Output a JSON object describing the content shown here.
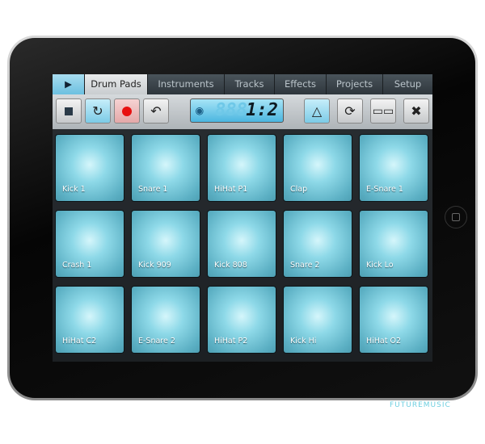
{
  "tabs": {
    "play_icon": "play-icon",
    "items": [
      "Drum Pads",
      "Instruments",
      "Tracks",
      "Effects",
      "Projects",
      "Setup"
    ],
    "active": "Drum Pads"
  },
  "toolbar": {
    "stop_icon": "stop-icon",
    "loop_icon": "loop-icon",
    "record_icon": "record-icon",
    "undo_icon": "undo-icon",
    "display_dim": "888",
    "display_value": "1:2",
    "metronome_icon": "metronome-icon",
    "rotate_icon": "rotate-icon",
    "piano_icon": "piano-icon",
    "fullscreen_icon": "expand-icon"
  },
  "pads": [
    "Kick 1",
    "Snare 1",
    "HiHat P1",
    "Clap",
    "E-Snare 1",
    "Crash 1",
    "Kick 909",
    "Kick 808",
    "Snare 2",
    "Kick Lo",
    "HiHat C2",
    "E-Snare 2",
    "HiHat P2",
    "Kick Hi",
    "HiHat O2"
  ],
  "watermark": "FUTUREMUSIC",
  "colors": {
    "accent": "#7ccbe6",
    "record": "#e81010",
    "pad": "#8ed9e8"
  }
}
